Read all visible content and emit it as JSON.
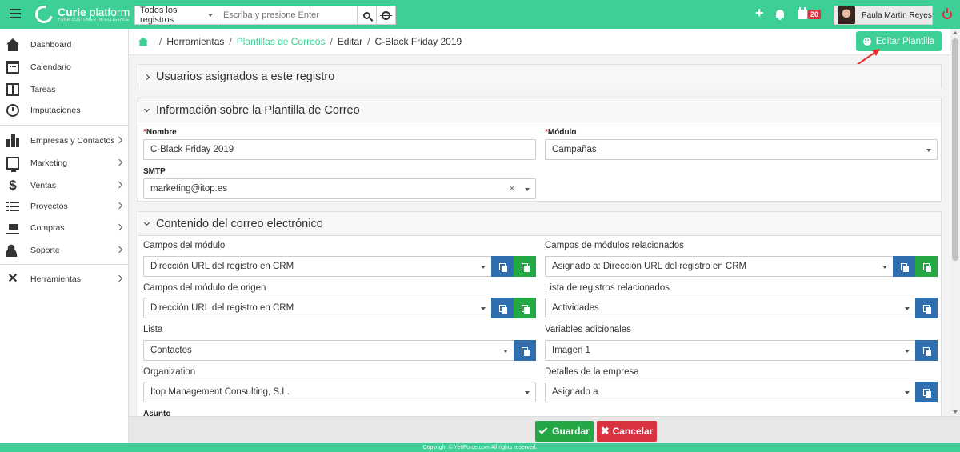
{
  "app": {
    "logo_name": "Curie",
    "logo_suffix": "platform",
    "logo_tagline": "YOUR CUSTOMER INTELLIGENCE"
  },
  "search": {
    "scope": "Todos los registros",
    "placeholder": "Escriba y presione Enter"
  },
  "topbar": {
    "calendar_badge": "20",
    "user_name": "Paula Martín Reyes"
  },
  "sidebar": {
    "items": [
      {
        "label": "Dashboard",
        "icon": "home-icon"
      },
      {
        "label": "Calendario",
        "icon": "calendar-icon"
      },
      {
        "label": "Tareas",
        "icon": "tasks-icon"
      },
      {
        "label": "Imputaciones",
        "icon": "clock-icon"
      },
      {
        "label": "Empresas y Contactos",
        "icon": "building-icon"
      },
      {
        "label": "Marketing",
        "icon": "monitor-icon"
      },
      {
        "label": "Ventas",
        "icon": "dollar-icon"
      },
      {
        "label": "Proyectos",
        "icon": "list-icon"
      },
      {
        "label": "Compras",
        "icon": "cart-icon"
      },
      {
        "label": "Soporte",
        "icon": "support-icon"
      },
      {
        "label": "Herramientas",
        "icon": "tools-icon"
      }
    ]
  },
  "breadcrumb": {
    "item1": "Herramientas",
    "item2": "Plantillas de Correos",
    "item3": "Editar",
    "item4": "C-Black Friday 2019"
  },
  "actions": {
    "edit_template": "Editar Plantilla"
  },
  "panels": {
    "assigned_users": "Usuarios asignados a este registro",
    "template_info": "Información sobre la Plantilla de Correo",
    "email_content": "Contenido del correo electrónico"
  },
  "form": {
    "nombre_label": "Nombre",
    "nombre_value": "C-Black Friday 2019",
    "modulo_label": "Módulo",
    "modulo_value": "Campañas",
    "smtp_label": "SMTP",
    "smtp_value": "marketing@itop.es",
    "clear_symbol": "×"
  },
  "content": {
    "campos_modulo_label": "Campos del módulo",
    "campos_modulo_value": "Dirección URL del registro en CRM",
    "campos_rel_label": "Campos de módulos relacionados",
    "campos_rel_value": "Asignado a: Dirección URL del registro en CRM",
    "campos_origen_label": "Campos del módulo de origen",
    "campos_origen_value": "Dirección URL del registro en CRM",
    "lista_rel_label": "Lista de registros relacionados",
    "lista_rel_value": "Actividades",
    "lista_label": "Lista",
    "lista_value": "Contactos",
    "variables_label": "Variables adicionales",
    "variables_value": "Imagen 1",
    "org_label": "Organization",
    "org_value": "Itop Management Consulting, S.L.",
    "empresa_label": "Detalles de la empresa",
    "empresa_value": "Asignado a",
    "asunto_label": "Asunto"
  },
  "bottom": {
    "save": "Guardar",
    "cancel": "Cancelar",
    "cancel_symbol": "✖"
  },
  "footer": {
    "copyright": "Copyright © YetiForce.com All rights reserved."
  },
  "colors": {
    "brand": "#3ecf96",
    "blue": "#2f6fb0",
    "green": "#23a845",
    "red": "#d9333f"
  }
}
